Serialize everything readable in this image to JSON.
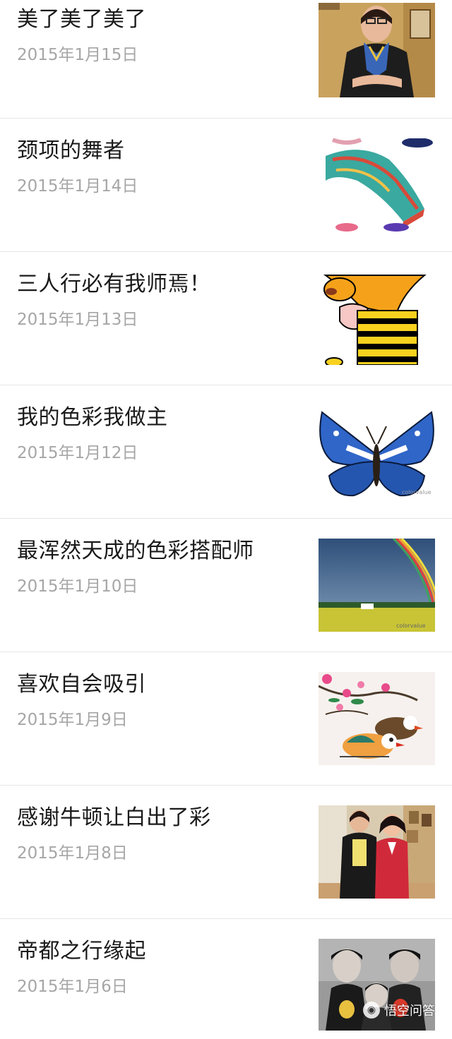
{
  "articles": [
    {
      "title": "美了美了美了",
      "date": "2015年1月15日",
      "thumb": "portrait-woman-scarf"
    },
    {
      "title": "颈项的舞者",
      "date": "2015年1月14日",
      "thumb": "silk-scarf"
    },
    {
      "title": "三人行必有我师焉！",
      "date": "2015年1月13日",
      "thumb": "cartoon-bee-character"
    },
    {
      "title": "我的色彩我做主",
      "date": "2015年1月12日",
      "thumb": "blue-butterfly"
    },
    {
      "title": "最浑然天成的色彩搭配师",
      "date": "2015年1月10日",
      "thumb": "rainbow-field"
    },
    {
      "title": "喜欢自会吸引",
      "date": "2015年1月9日",
      "thumb": "mandarin-ducks-flowers"
    },
    {
      "title": "感谢牛顿让白出了彩",
      "date": "2015年1月8日",
      "thumb": "two-women-photo"
    },
    {
      "title": "帝都之行缘起",
      "date": "2015年1月6日",
      "thumb": "family-painting"
    }
  ],
  "watermark": {
    "label": "悟空问答",
    "icon": "wukong-logo-icon"
  },
  "colors": {
    "title": "#1a1a1a",
    "date": "#a6a6a6",
    "divider": "#e6e6e6"
  }
}
